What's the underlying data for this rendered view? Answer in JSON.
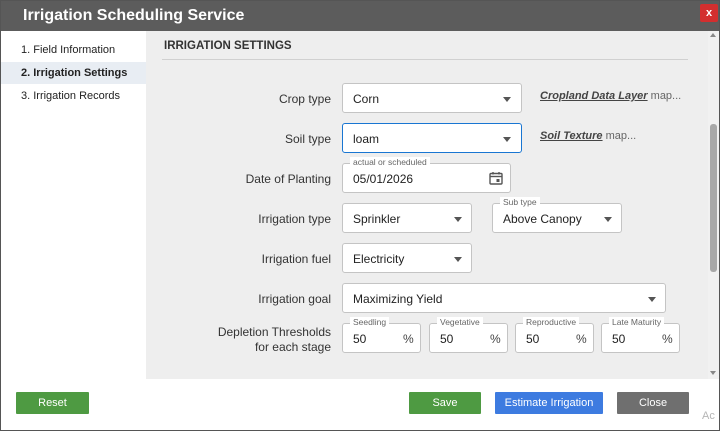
{
  "window": {
    "title": "Irrigation Scheduling Service",
    "close_glyph": "x"
  },
  "nav": {
    "items": [
      {
        "label": "1. Field Information",
        "active": false
      },
      {
        "label": "2. Irrigation Settings",
        "active": true
      },
      {
        "label": "3. Irrigation Records",
        "active": false
      }
    ]
  },
  "section": {
    "title": "IRRIGATION SETTINGS"
  },
  "form": {
    "crop_type": {
      "label": "Crop type",
      "value": "Corn",
      "link_bold": "Cropland Data Layer",
      "link_rest": "map..."
    },
    "soil_type": {
      "label": "Soil type",
      "value": "loam",
      "link_bold": "Soil Texture",
      "link_rest": "map..."
    },
    "planting": {
      "label": "Date of Planting",
      "hint": "actual or scheduled",
      "value": "05/01/2026"
    },
    "irrigation_type": {
      "label": "Irrigation type",
      "value": "Sprinkler",
      "sub_label": "Sub type",
      "sub_value": "Above Canopy"
    },
    "irrigation_fuel": {
      "label": "Irrigation fuel",
      "value": "Electricity"
    },
    "irrigation_goal": {
      "label": "Irrigation goal",
      "value": "Maximizing Yield"
    },
    "depletion": {
      "label_line1": "Depletion Thresholds",
      "label_line2": "for each stage",
      "unit": "%",
      "stages": [
        {
          "name": "Seedling",
          "value": "50"
        },
        {
          "name": "Vegetative",
          "value": "50"
        },
        {
          "name": "Reproductive",
          "value": "50"
        },
        {
          "name": "Late Maturity",
          "value": "50"
        }
      ]
    }
  },
  "footer": {
    "reset": "Reset",
    "save": "Save",
    "estimate": "Estimate Irrigation",
    "close": "Close"
  },
  "overlay": {
    "watermark": "Ac"
  },
  "colors": {
    "titlebar": "#5c5c5c",
    "close_button": "#d32f2f",
    "green_button": "#4e9a42",
    "blue_button": "#3d7be0",
    "gray_button": "#6f6f6f",
    "focus_border": "#1976d2"
  }
}
